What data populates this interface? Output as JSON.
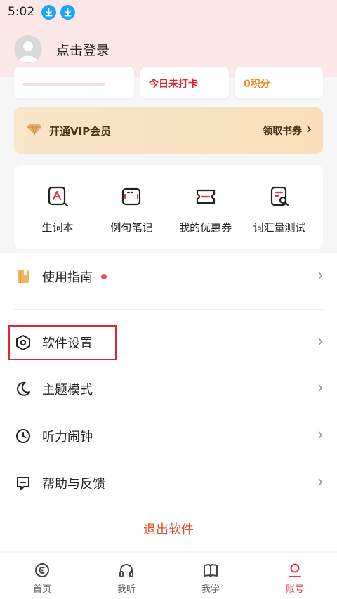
{
  "status_bar": {
    "time": "5:02"
  },
  "header": {
    "login_text": "点击登录"
  },
  "stats": {
    "checkin": "今日未打卡",
    "points": "0积分"
  },
  "vip": {
    "label": "开通VIP会员",
    "action": "领取书券"
  },
  "tools": [
    {
      "label": "生词本",
      "icon": "vocabulary-book-icon"
    },
    {
      "label": "例句笔记",
      "icon": "sentence-notes-icon"
    },
    {
      "label": "我的优惠券",
      "icon": "coupon-icon"
    },
    {
      "label": "词汇量测试",
      "icon": "vocabulary-test-icon"
    }
  ],
  "menu": {
    "guide": "使用指南",
    "settings": "软件设置",
    "theme": "主题模式",
    "alarm": "听力闹钟",
    "help": "帮助与反馈",
    "logout": "退出软件"
  },
  "nav": {
    "home": "首页",
    "listen": "我听",
    "learn": "我学",
    "account": "账号"
  },
  "colors": {
    "accent": "#e23a47",
    "header_bg": "#fbe7e8",
    "vip_bg": "#f9e5c9",
    "logout": "#e05230"
  }
}
